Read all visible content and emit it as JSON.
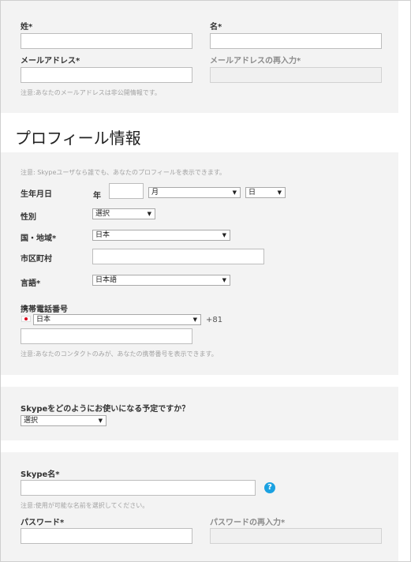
{
  "account": {
    "last_name_label": "姓*",
    "first_name_label": "名*",
    "email_label": "メールアドレス*",
    "email_confirm_label": "メールアドレスの再入力*",
    "email_note": "注意:あなたのメールアドレスは非公開情報です。"
  },
  "profile": {
    "heading": "プロフィール情報",
    "note": "注意: Skypeユーザなら誰でも、あなたのプロフィールを表示できます。",
    "birthdate_label": "生年月日",
    "year_label": "年",
    "month_value": "月",
    "day_value": "日",
    "gender_label": "性別",
    "gender_value": "選択",
    "country_label": "国・地域*",
    "country_value": "日本",
    "city_label": "市区町村",
    "language_label": "言語*",
    "language_value": "日本語",
    "mobile_label": "携帯電話番号",
    "mobile_country_value": "日本",
    "country_code": "+81",
    "mobile_note": "注意:あなたのコンタクトのみが、あなたの携帯番号を表示できます。"
  },
  "usage": {
    "question": "Skypeをどのようにお使いになる予定ですか？",
    "value": "選択"
  },
  "skype": {
    "name_label": "Skype名*",
    "help_glyph": "?",
    "name_note": "注意:使用が可能な名前を選択してください。",
    "password_label": "パスワード*",
    "password_confirm_label": "パスワードの再入力*"
  }
}
